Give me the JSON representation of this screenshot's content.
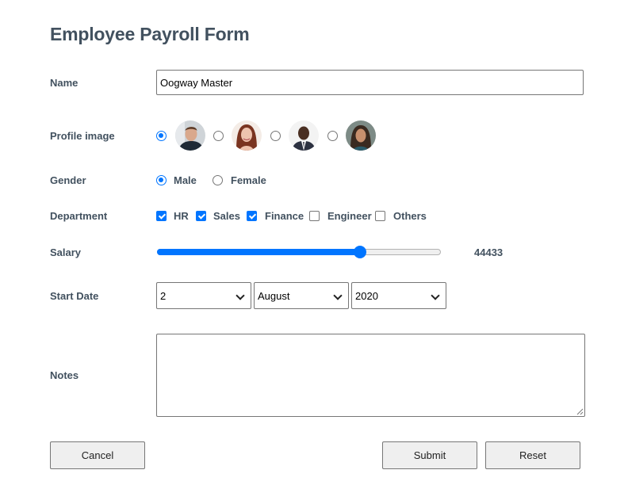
{
  "form": {
    "title": "Employee Payroll Form"
  },
  "name": {
    "label": "Name",
    "value": "Oogway Master"
  },
  "profile": {
    "label": "Profile image",
    "selected_index": 0,
    "options": [
      "profile-1",
      "profile-2",
      "profile-3",
      "profile-4"
    ]
  },
  "gender": {
    "label": "Gender",
    "options": [
      {
        "label": "Male",
        "checked": true
      },
      {
        "label": "Female",
        "checked": false
      }
    ]
  },
  "department": {
    "label": "Department",
    "options": [
      {
        "label": "HR",
        "checked": true
      },
      {
        "label": "Sales",
        "checked": true
      },
      {
        "label": "Finance",
        "checked": true
      },
      {
        "label": "Engineer",
        "checked": false
      },
      {
        "label": "Others",
        "checked": false
      }
    ]
  },
  "salary": {
    "label": "Salary",
    "value": "44433",
    "slider_fraction": 0.715
  },
  "start_date": {
    "label": "Start Date",
    "day": "2",
    "month": "August",
    "year": "2020"
  },
  "notes": {
    "label": "Notes",
    "value": ""
  },
  "buttons": {
    "cancel": "Cancel",
    "submit": "Submit",
    "reset": "Reset"
  },
  "colors": {
    "accent": "#0075ff",
    "label_text": "#42515f",
    "button_bg": "#efefef"
  }
}
